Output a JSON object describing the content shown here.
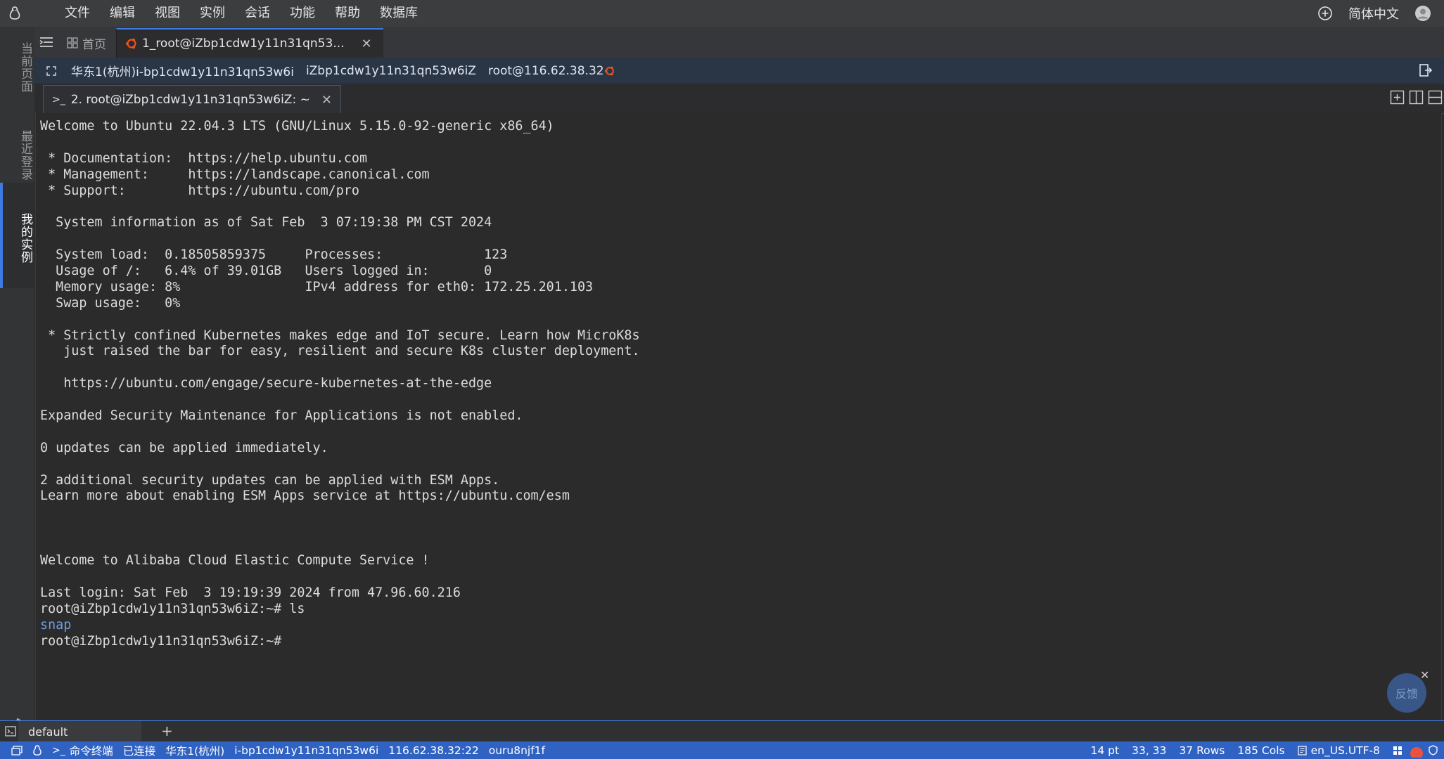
{
  "menu": {
    "items": [
      "文件",
      "编辑",
      "视图",
      "实例",
      "会话",
      "功能",
      "帮助",
      "数据库"
    ],
    "language": "简体中文"
  },
  "rail": {
    "current_page": "当前页面",
    "recent_logins": "最近登录",
    "my_instances": "我的实例"
  },
  "tabs": {
    "home": "首页",
    "session": "1_root@iZbp1cdw1y11n31qn53..."
  },
  "infobar": {
    "region_instance": "华东1(杭州)i-bp1cdw1y11n31qn53w6i",
    "hostname": "iZbp1cdw1y11n31qn53w6iZ",
    "user_ip": "root@116.62.38.32"
  },
  "terminal_tab": {
    "prefix": ">_",
    "label": "2. root@iZbp1cdw1y11n31qn53w6iZ: ~"
  },
  "terminal": {
    "lines": [
      {
        "text": "Welcome to Ubuntu 22.04.3 LTS (GNU/Linux 5.15.0-92-generic x86_64)"
      },
      {
        "text": ""
      },
      {
        "text": " * Documentation:  https://help.ubuntu.com"
      },
      {
        "text": " * Management:     https://landscape.canonical.com"
      },
      {
        "text": " * Support:        https://ubuntu.com/pro"
      },
      {
        "text": ""
      },
      {
        "text": "  System information as of Sat Feb  3 07:19:38 PM CST 2024"
      },
      {
        "text": ""
      },
      {
        "text": "  System load:  0.18505859375     Processes:             123"
      },
      {
        "text": "  Usage of /:   6.4% of 39.01GB   Users logged in:       0"
      },
      {
        "text": "  Memory usage: 8%                IPv4 address for eth0: 172.25.201.103"
      },
      {
        "text": "  Swap usage:   0%"
      },
      {
        "text": ""
      },
      {
        "text": " * Strictly confined Kubernetes makes edge and IoT secure. Learn how MicroK8s"
      },
      {
        "text": "   just raised the bar for easy, resilient and secure K8s cluster deployment."
      },
      {
        "text": ""
      },
      {
        "text": "   https://ubuntu.com/engage/secure-kubernetes-at-the-edge"
      },
      {
        "text": ""
      },
      {
        "text": "Expanded Security Maintenance for Applications is not enabled."
      },
      {
        "text": ""
      },
      {
        "text": "0 updates can be applied immediately."
      },
      {
        "text": ""
      },
      {
        "text": "2 additional security updates can be applied with ESM Apps."
      },
      {
        "text": "Learn more about enabling ESM Apps service at https://ubuntu.com/esm"
      },
      {
        "text": ""
      },
      {
        "text": ""
      },
      {
        "text": ""
      },
      {
        "text": "Welcome to Alibaba Cloud Elastic Compute Service !"
      },
      {
        "text": ""
      },
      {
        "text": "Last login: Sat Feb  3 19:19:39 2024 from 47.96.60.216"
      },
      {
        "text": "root@iZbp1cdw1y11n31qn53w6iZ:~# ls"
      },
      {
        "text": "snap",
        "kind": "dir"
      },
      {
        "text": "root@iZbp1cdw1y11n31qn53w6iZ:~#"
      }
    ],
    "feedback_label": "反馈"
  },
  "panel": {
    "tab_label": "default",
    "add_label": "+"
  },
  "status": {
    "terminal_prefix": ">_",
    "terminal_label": "命令终端",
    "connection": "已连接",
    "region": "华东1(杭州)",
    "instance_id": "i-bp1cdw1y11n31qn53w6i",
    "address": "116.62.38.32:22",
    "session_id": "ouru8njf1f",
    "font_size": "14 pt",
    "cursor": "33, 33",
    "rows": "37 Rows",
    "cols": "185 Cols",
    "encoding": "en_US.UTF-8"
  },
  "colors": {
    "accent": "#3d7be0",
    "status_bar": "#2f62c2",
    "ubuntu_icon": "#e95420",
    "directory": "#6e9de5"
  }
}
